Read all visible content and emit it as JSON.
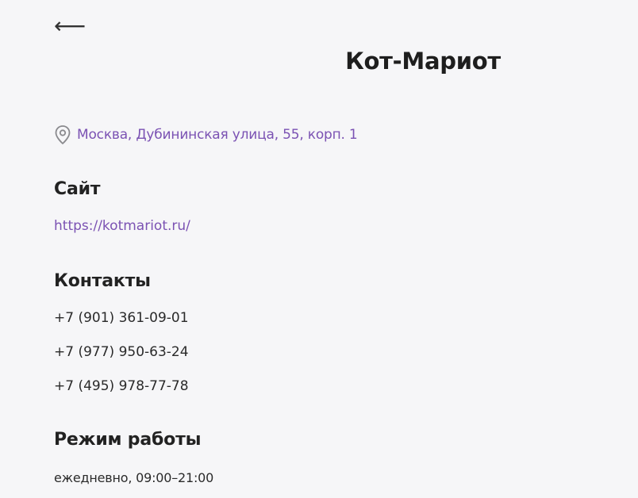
{
  "nav": {
    "back_icon": "left-arrow-icon",
    "back_glyph": "⟵"
  },
  "header": {
    "title": "Кот-Мариот"
  },
  "address": {
    "icon": "location-pin-icon",
    "text": "Москва, Дубининская улица, 55, корп. 1",
    "color": "#7b52b3"
  },
  "website": {
    "heading": "Сайт",
    "url": "https://kotmariot.ru/"
  },
  "contacts": {
    "heading": "Контакты",
    "phones": [
      "+7 (901) 361-09-01",
      "+7 (977) 950-63-24",
      "+7 (495) 978-77-78"
    ]
  },
  "schedule": {
    "heading": "Режим работы",
    "hours": "ежедневно, 09:00–21:00"
  },
  "colors": {
    "background": "#f6f6f8",
    "accent": "#7b52b3",
    "text": "#222222"
  }
}
